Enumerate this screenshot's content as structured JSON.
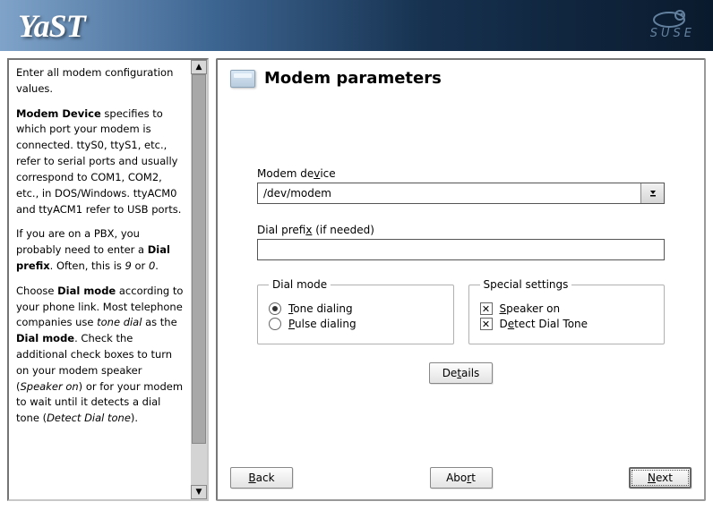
{
  "header": {
    "app_name": "YaST",
    "brand": "SUSE"
  },
  "help": {
    "p1a": "Enter all modem configuration values.",
    "p2a": "Modem Device",
    "p2b": " specifies to which port your modem is connected. ttyS0, ttyS1, etc., refer to serial ports and usually correspond to COM1, COM2, etc., in DOS/Windows. ttyACM0 and ttyACM1 refer to USB ports.",
    "p3a": "If you are on a PBX, you probably need to enter a ",
    "p3b": "Dial prefix",
    "p3c": ". Often, this is ",
    "p3d": "9",
    "p3e": " or ",
    "p3f": "0",
    "p3g": ".",
    "p4a": "Choose ",
    "p4b": "Dial mode",
    "p4c": " according to your phone link. Most telephone companies use ",
    "p4d": "tone dial",
    "p4e": " as the ",
    "p4f": "Dial mode",
    "p4g": ". Check the additional check boxes to turn on your modem speaker (",
    "p4h": "Speaker on",
    "p4i": ") or for your modem to wait until it detects a dial tone (",
    "p4j": "Detect Dial tone",
    "p4k": ")."
  },
  "main": {
    "title": "Modem parameters",
    "modem_device_label_pre": "Modem de",
    "modem_device_label_u": "v",
    "modem_device_label_post": "ice",
    "modem_device_value": "/dev/modem",
    "dial_prefix_label_pre": "Dial prefi",
    "dial_prefix_label_u": "x",
    "dial_prefix_label_post": " (if needed)",
    "dial_prefix_value": "",
    "dial_mode_legend": "Dial mode",
    "tone_u": "T",
    "tone_rest": "one dialing",
    "pulse_u": "P",
    "pulse_rest": "ulse dialing",
    "special_legend": "Special settings",
    "speaker_u": "S",
    "speaker_rest": "peaker on",
    "detect_pre": "D",
    "detect_u": "e",
    "detect_post": "tect Dial Tone",
    "details_pre": "De",
    "details_u": "t",
    "details_post": "ails",
    "back_u": "B",
    "back_rest": "ack",
    "abort_pre": "Abo",
    "abort_u": "r",
    "abort_post": "t",
    "next_u": "N",
    "next_rest": "ext"
  }
}
